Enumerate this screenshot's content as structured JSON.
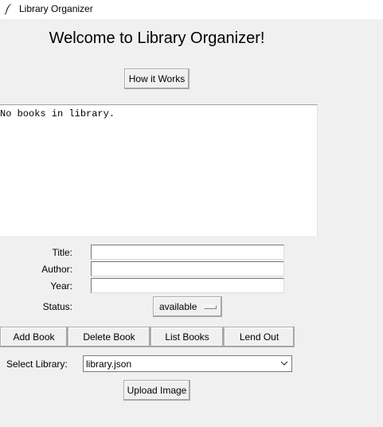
{
  "window": {
    "title": "Library Organizer",
    "icon": "feather-icon"
  },
  "header": {
    "welcome": "Welcome to Library Organizer!"
  },
  "buttons": {
    "how_it_works": "How it Works",
    "upload_image": "Upload Image"
  },
  "display": {
    "text": "No books in library."
  },
  "form": {
    "title_label": "Title:",
    "author_label": "Author:",
    "year_label": "Year:",
    "status_label": "Status:",
    "title_value": "",
    "author_value": "",
    "year_value": "",
    "status_value": "available"
  },
  "actions": {
    "add": "Add Book",
    "delete": "Delete Book",
    "list": "List Books",
    "lend": "Lend Out"
  },
  "library": {
    "label": "Select Library:",
    "selected": "library.json",
    "icon": "chevron-down-icon"
  }
}
